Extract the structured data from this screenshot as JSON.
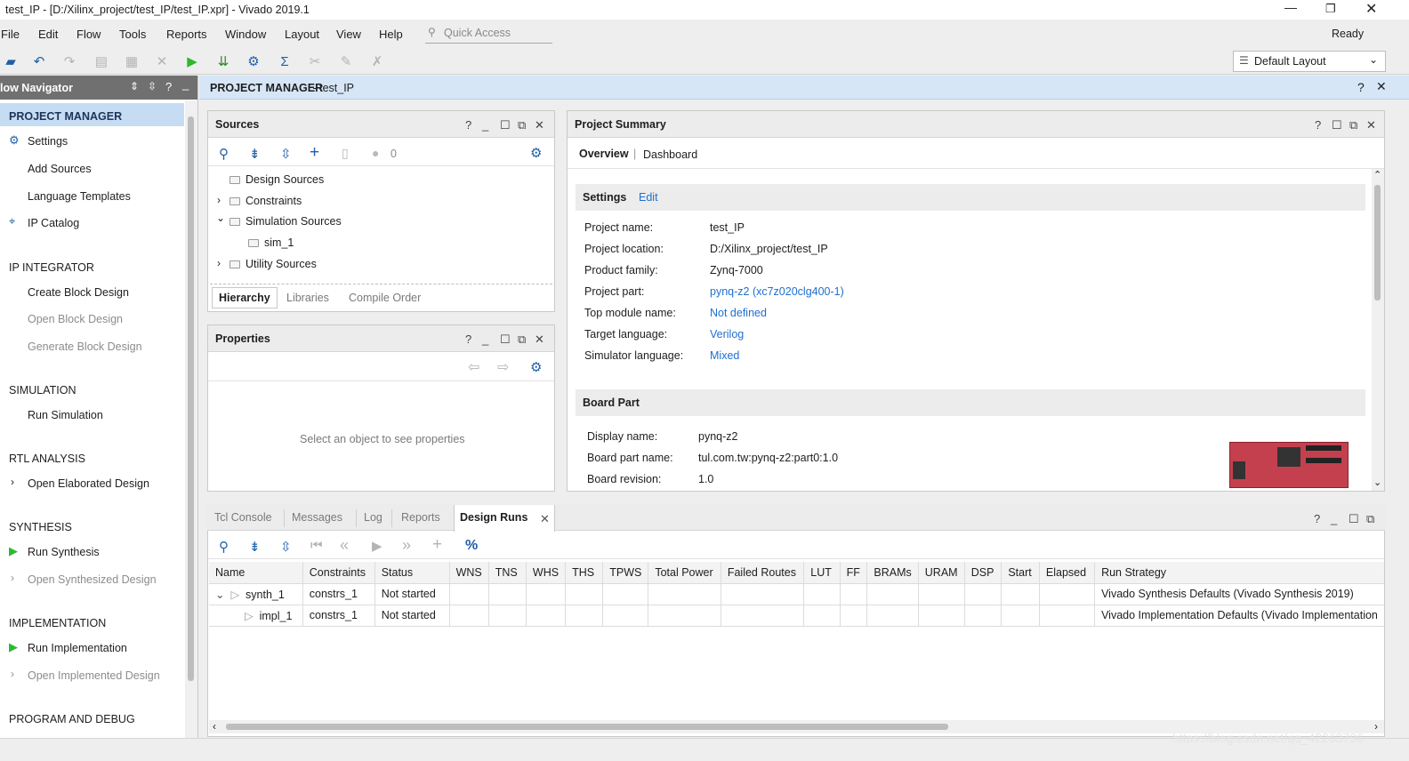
{
  "window": {
    "title": "test_IP - [D:/Xilinx_project/test_IP/test_IP.xpr] - Vivado 2019.1",
    "status": "Ready"
  },
  "menu": [
    "File",
    "Edit",
    "Flow",
    "Tools",
    "Reports",
    "Window",
    "Layout",
    "View",
    "Help"
  ],
  "quick_access": {
    "placeholder": "Quick Access"
  },
  "layout_select": {
    "value": "Default Layout"
  },
  "flow_nav": {
    "title": "low Navigator",
    "project_manager": "PROJECT MANAGER",
    "settings": "Settings",
    "add_sources": "Add Sources",
    "language_templates": "Language Templates",
    "ip_catalog": "IP Catalog",
    "ip_integrator": "IP INTEGRATOR",
    "create_block": "Create Block Design",
    "open_block": "Open Block Design",
    "generate_block": "Generate Block Design",
    "simulation": "SIMULATION",
    "run_simulation": "Run Simulation",
    "rtl_analysis": "RTL ANALYSIS",
    "open_elaborated": "Open Elaborated Design",
    "synthesis": "SYNTHESIS",
    "run_synthesis": "Run Synthesis",
    "open_synthesized": "Open Synthesized Design",
    "implementation": "IMPLEMENTATION",
    "run_implementation": "Run Implementation",
    "open_implemented": "Open Implemented Design",
    "program_debug": "PROGRAM AND DEBUG"
  },
  "pm_header": {
    "title": "PROJECT MANAGER",
    "sub": " - test_IP"
  },
  "sources": {
    "title": "Sources",
    "count": "0",
    "tree": [
      "Design Sources",
      "Constraints",
      "Simulation Sources",
      "sim_1",
      "Utility Sources"
    ],
    "tabs": [
      "Hierarchy",
      "Libraries",
      "Compile Order"
    ]
  },
  "properties": {
    "title": "Properties",
    "empty": "Select an object to see properties"
  },
  "summary": {
    "title": "Project Summary",
    "tab_overview": "Overview",
    "tab_dashboard": "Dashboard",
    "settings_title": "Settings",
    "edit": "Edit",
    "rows": [
      {
        "label": "Project name:",
        "value": "test_IP"
      },
      {
        "label": "Project location:",
        "value": "D:/Xilinx_project/test_IP"
      },
      {
        "label": "Product family:",
        "value": "Zynq-7000"
      },
      {
        "label": "Project part:",
        "value": "pynq-z2 (xc7z020clg400-1)"
      },
      {
        "label": "Top module name:",
        "value": "Not defined"
      },
      {
        "label": "Target language:",
        "value": "Verilog"
      },
      {
        "label": "Simulator language:",
        "value": "Mixed"
      }
    ],
    "board_title": "Board Part",
    "board_rows": [
      {
        "label": "Display name:",
        "value": "pynq-z2"
      },
      {
        "label": "Board part name:",
        "value": "tul.com.tw:pynq-z2:part0:1.0"
      },
      {
        "label": "Board revision:",
        "value": "1.0"
      }
    ]
  },
  "bottom": {
    "tabs": [
      "Tcl Console",
      "Messages",
      "Log",
      "Reports",
      "Design Runs"
    ],
    "columns": [
      "Name",
      "Constraints",
      "Status",
      "WNS",
      "TNS",
      "WHS",
      "THS",
      "TPWS",
      "Total Power",
      "Failed Routes",
      "LUT",
      "FF",
      "BRAMs",
      "URAM",
      "DSP",
      "Start",
      "Elapsed",
      "Run Strategy"
    ],
    "runs": [
      {
        "name": "synth_1",
        "constraints": "constrs_1",
        "status": "Not started",
        "strategy": "Vivado Synthesis Defaults (Vivado Synthesis 2019)"
      },
      {
        "name": "impl_1",
        "constraints": "constrs_1",
        "status": "Not started",
        "strategy": "Vivado Implementation Defaults (Vivado Implementation"
      }
    ]
  },
  "watermark": "https://blog.csdn.net/qq_42263796",
  "colors": {
    "accent": "#1f6fd1",
    "nav_selected": "#c5dcf3",
    "header_blue": "#d6e6f7",
    "green": "#2db82d"
  }
}
